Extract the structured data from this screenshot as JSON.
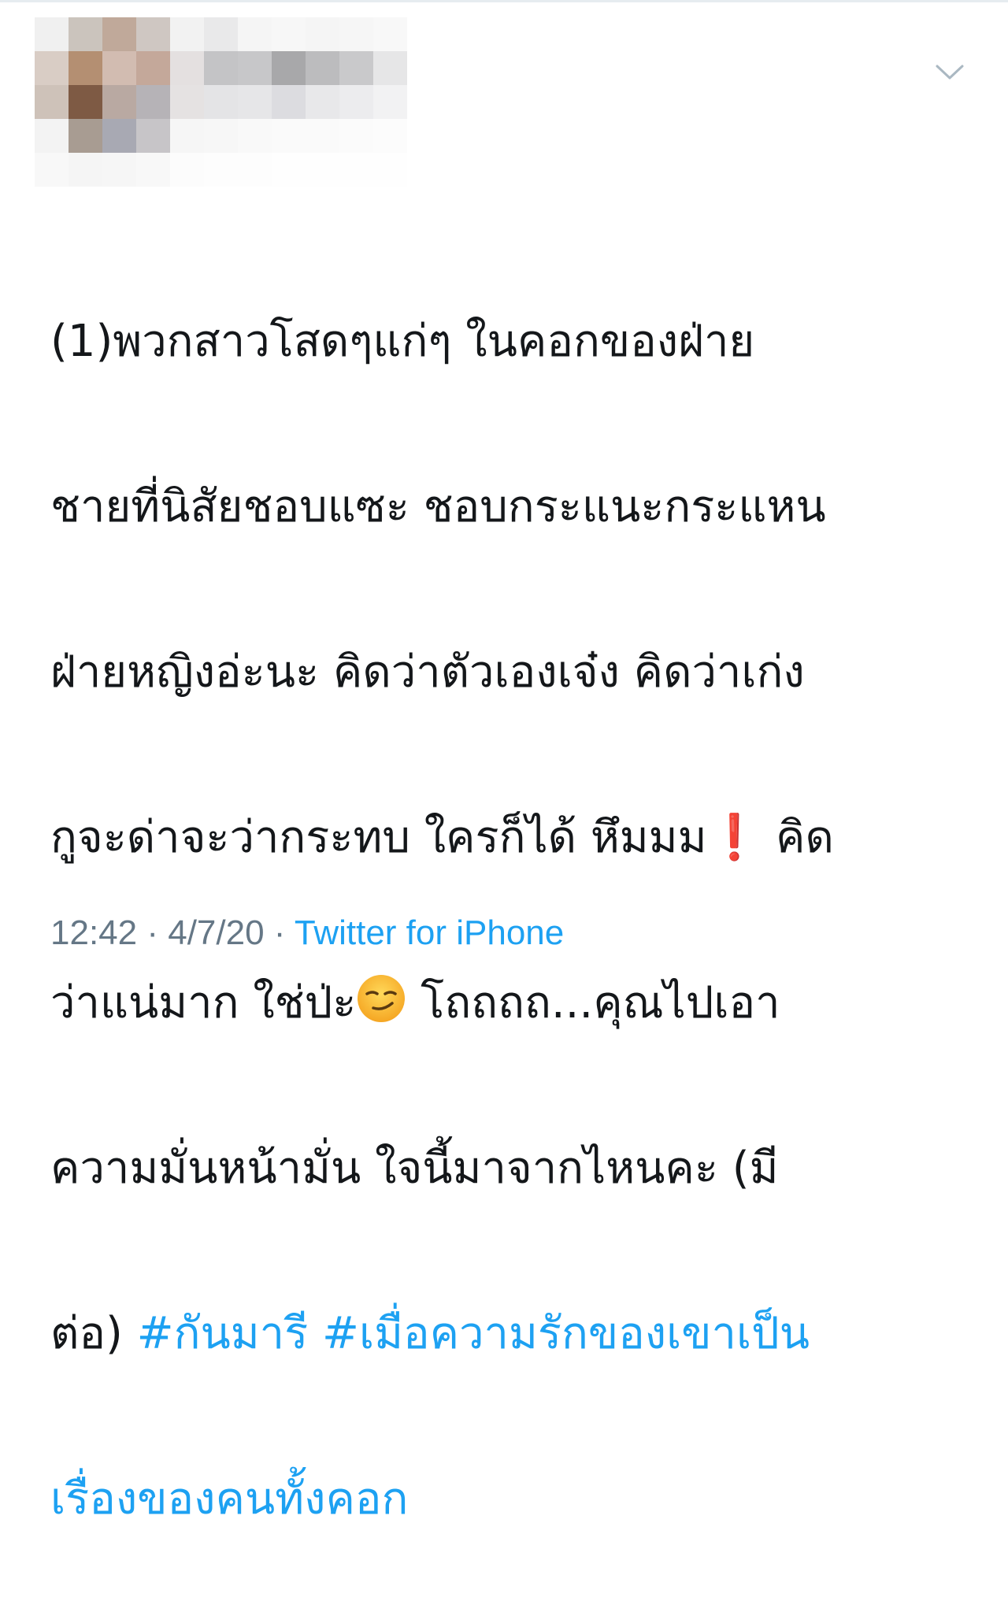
{
  "header": {
    "menu_icon": "chevron-down-icon"
  },
  "avatar_colors": [
    [
      "#f0f0f0",
      "#cbc4bd",
      "#c0a99a",
      "#cfc7c2",
      "#f2f2f2",
      "#e9e9ea",
      "#f5f5f5",
      "#f7f7f7",
      "#f5f5f5",
      "#f6f6f6",
      "#f8f8f8"
    ],
    [
      "#d9cdc5",
      "#b48f72",
      "#d2bcb1",
      "#c4a89a",
      "#e4e0e0",
      "#c4c4c6",
      "#c7c7c9",
      "#a8a8aa",
      "#bcbcbe",
      "#c9c9cb",
      "#e6e6e7"
    ],
    [
      "#cec2b9",
      "#7e5a44",
      "#b9a9a2",
      "#b6b3b7",
      "#e5e2e2",
      "#e4e4e6",
      "#e6e6e8",
      "#dcdce0",
      "#e8e8ea",
      "#ececee",
      "#f2f2f3"
    ],
    [
      "#f3f3f3",
      "#a89c92",
      "#a8a9b3",
      "#c7c5c8",
      "#f6f6f6",
      "#f7f7f7",
      "#f9f9f9",
      "#fafafa",
      "#fafafa",
      "#fbfbfb",
      "#fcfcfc"
    ],
    [
      "#f8f8f8",
      "#f5f5f5",
      "#f6f6f6",
      "#f8f8f8",
      "#fcfcfc",
      "#fdfdfd",
      "#fdfdfd",
      "#fefefe",
      "#fefefe",
      "#fefefe",
      "#fefefe"
    ]
  ],
  "tweet": {
    "line1": "(1)พวกสาวโสดๆแก่ๆ ในคอกของฝ่าย",
    "line2": "ชายที่นิสัยชอบแซะ ชอบกระแนะกระแหน",
    "line3": "ฝ่ายหญิงอ่ะนะ คิดว่าตัวเองเจ๋ง คิดว่าเก่ง",
    "line4_a": "กูจะด่าจะว่ากระทบ ใครก็ได้ หึมมม",
    "line4_emoji": "❗",
    "line4_b": " คิด",
    "line5_a": "ว่าแน่มาก ใช่ป่ะ",
    "line5_b": " โถถถถ...คุณไปเอา",
    "line6": "ความมั่นหน้ามั่น ใจนี้มาจากไหนคะ (มี",
    "line7_a": "ต่อ) ",
    "hashtag1": "#กันมารี",
    "line7_sep": " ",
    "hashtag2_part1": "#เมื่อความรักของเขาเป็น",
    "hashtag2_part2": "เรื่องของคนทั้งคอก",
    "emoji_name": "smirking-face-icon"
  },
  "meta": {
    "time": "12:42",
    "sep1": " · ",
    "date": "4/7/20",
    "sep2": " · ",
    "source": "Twitter for iPhone"
  },
  "colors": {
    "link": "#1da1f2",
    "text": "#14171a",
    "meta": "#657786"
  }
}
